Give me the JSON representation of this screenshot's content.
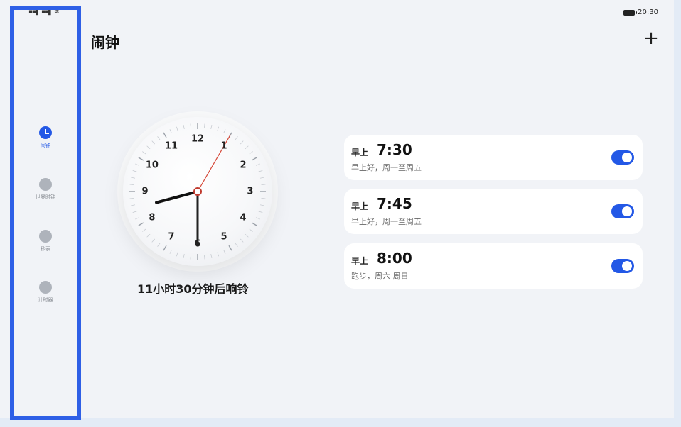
{
  "status_bar": {
    "signal": "▪▪▌ ▪▪▌ ≋",
    "time": "20:30"
  },
  "sidebar": {
    "items": [
      {
        "label": "闹钟",
        "icon": "alarm-clock-icon",
        "active": true
      },
      {
        "label": "世界时钟",
        "icon": "globe-icon",
        "active": false
      },
      {
        "label": "秒表",
        "icon": "stopwatch-icon",
        "active": false
      },
      {
        "label": "计时器",
        "icon": "timer-icon",
        "active": false
      }
    ]
  },
  "header": {
    "title": "闹钟",
    "add_label": "+"
  },
  "clock": {
    "numbers": [
      "12",
      "1",
      "2",
      "3",
      "4",
      "5",
      "6",
      "7",
      "8",
      "9",
      "10",
      "11"
    ],
    "hour": 8,
    "minute": 30,
    "second": 5
  },
  "ring_text": "11小时30分钟后响铃",
  "alarms": [
    {
      "period": "早上",
      "time": "7:30",
      "desc": "早上好，周一至周五",
      "enabled": true
    },
    {
      "period": "早上",
      "time": "7:45",
      "desc": "早上好，周一至周五",
      "enabled": true
    },
    {
      "period": "早上",
      "time": "8:00",
      "desc": "跑步，周六 周日",
      "enabled": true
    }
  ],
  "colors": {
    "accent": "#2358e6",
    "second_hand": "#d64a3a",
    "highlight_frame": "#2e5fe6"
  }
}
